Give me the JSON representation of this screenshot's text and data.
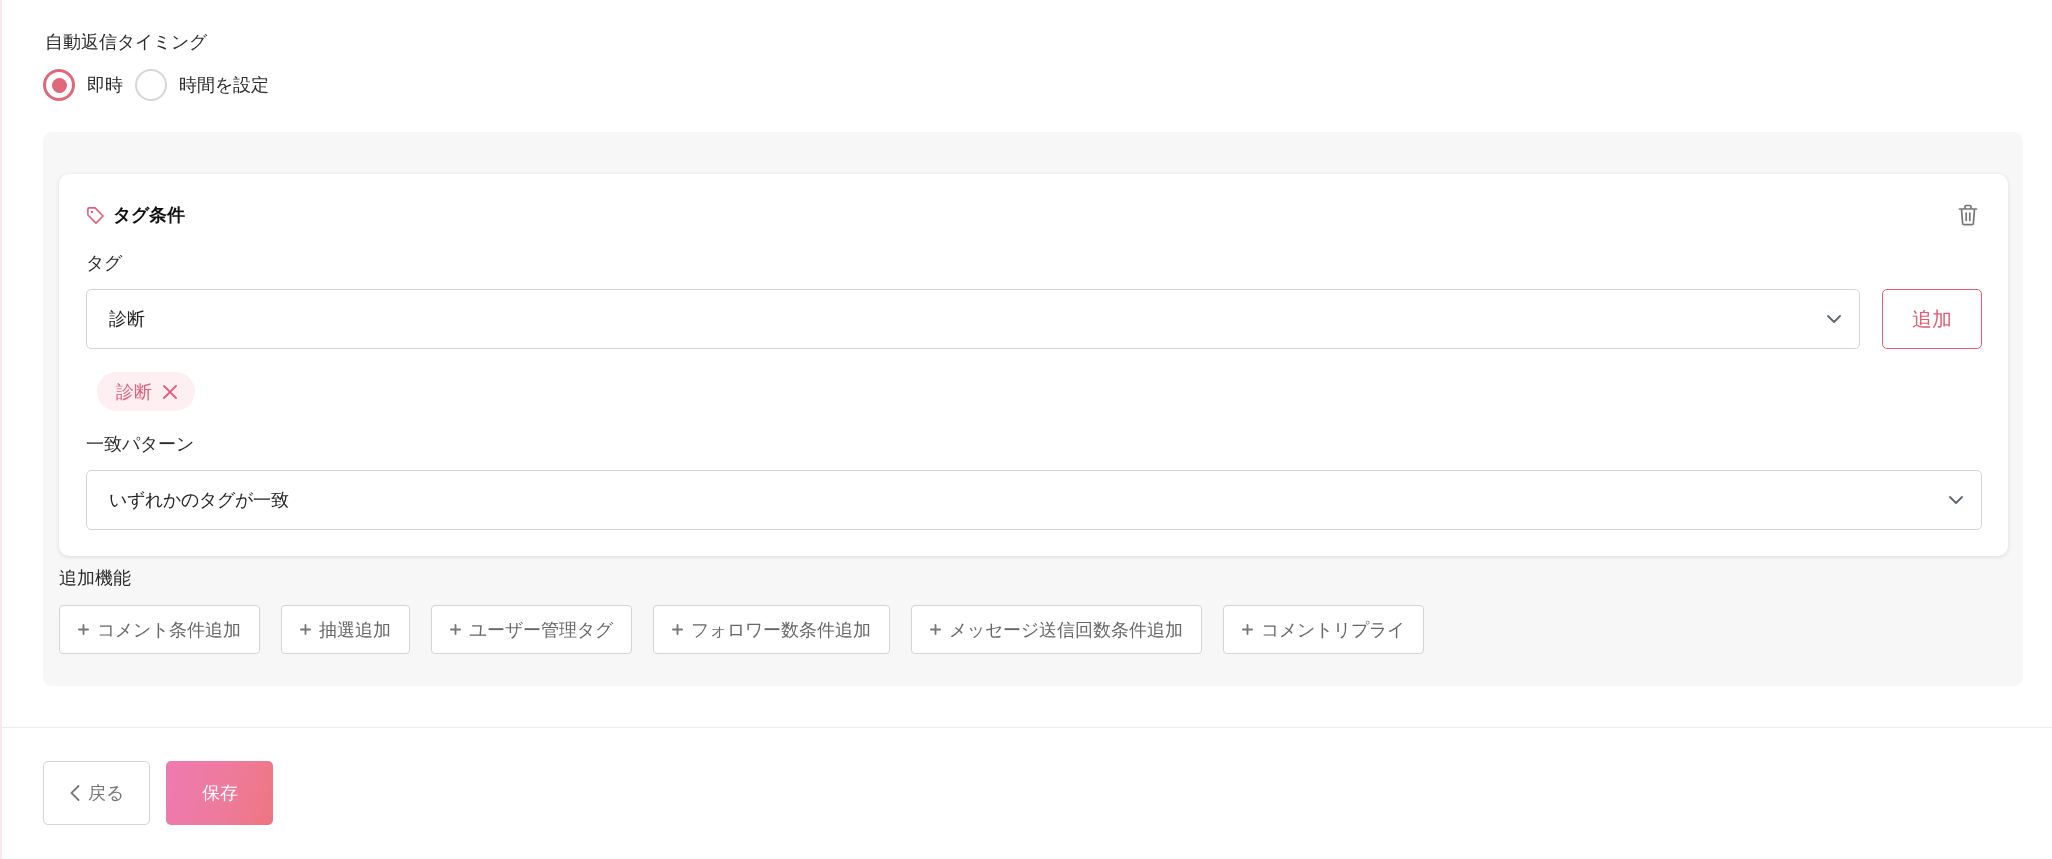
{
  "auto_reply_timing": {
    "label": "自動返信タイミング",
    "options": [
      {
        "label": "即時",
        "selected": true
      },
      {
        "label": "時間を設定",
        "selected": false
      }
    ]
  },
  "tag_condition": {
    "title": "タグ条件",
    "tag_field": {
      "label": "タグ",
      "value": "診断"
    },
    "add_button": "追加",
    "selected_tags": [
      {
        "label": "診断"
      }
    ],
    "match_pattern": {
      "label": "一致パターン",
      "value": "いずれかのタグが一致"
    }
  },
  "extra_features": {
    "label": "追加機能",
    "buttons": [
      "コメント条件追加",
      "抽選追加",
      "ユーザー管理タグ",
      "フォロワー数条件追加",
      "メッセージ送信回数条件追加",
      "コメントリプライ"
    ]
  },
  "footer": {
    "back_button": "戻る",
    "save_button": "保存"
  }
}
